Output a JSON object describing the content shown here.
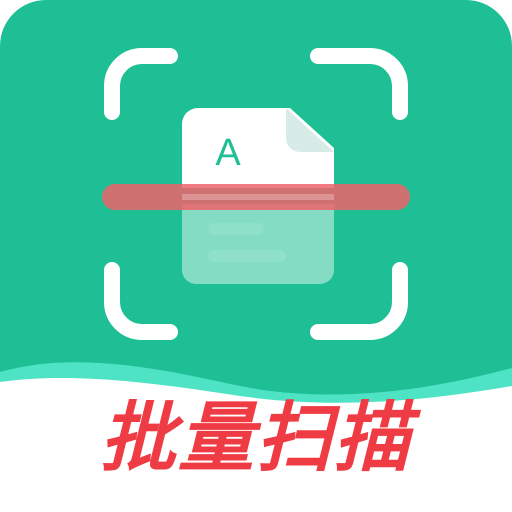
{
  "app_icon": {
    "doc_letter": "A",
    "caption": "批量扫描",
    "icons": {
      "viewfinder": "scan-frame-icon",
      "document": "document-icon",
      "scanline": "scan-line-icon"
    },
    "colors": {
      "teal": "#1fbf95",
      "wave": "#4fe3c6",
      "scan_line": "#f0636b",
      "caption": "#ef3b43",
      "frame": "#ffffff"
    }
  }
}
